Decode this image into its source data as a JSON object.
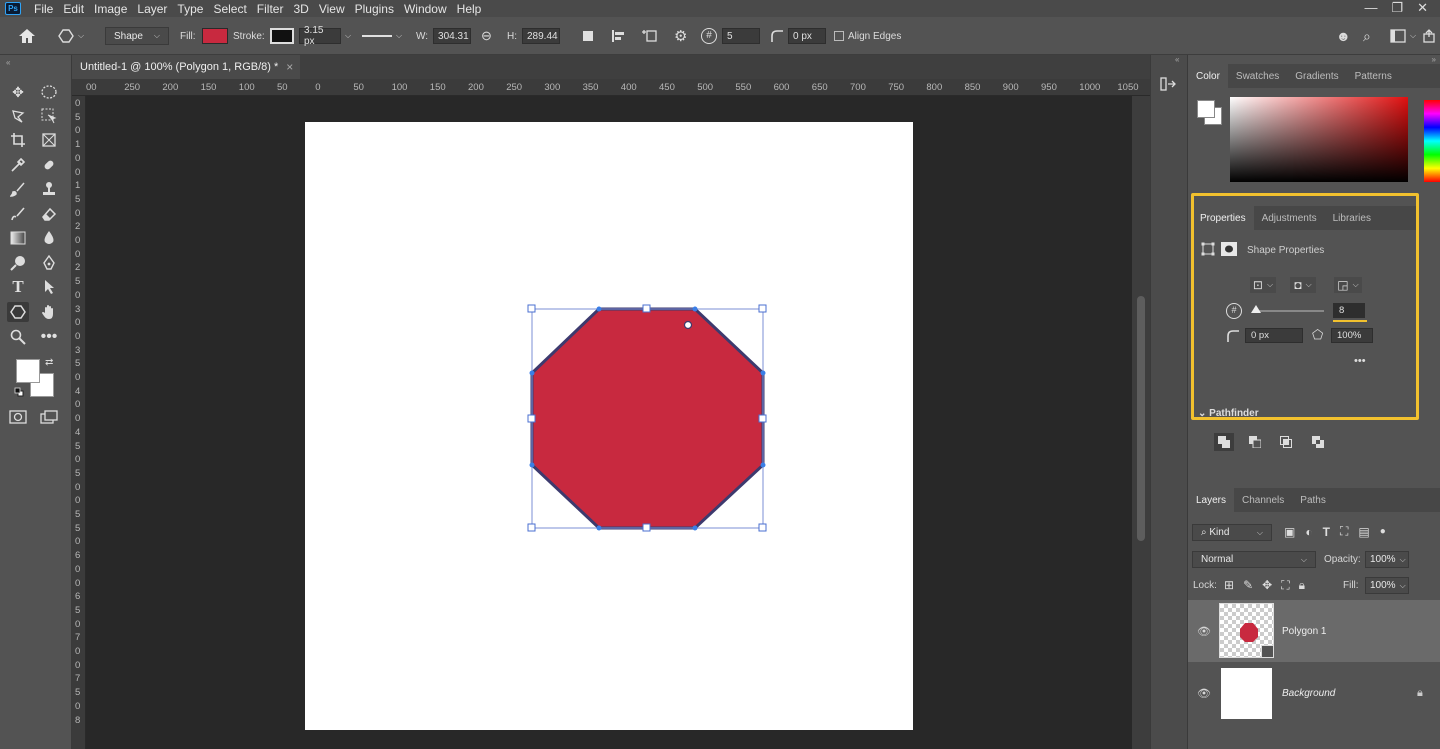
{
  "app": {
    "logo": "Ps"
  },
  "menu": [
    "File",
    "Edit",
    "Image",
    "Layer",
    "Type",
    "Select",
    "Filter",
    "3D",
    "View",
    "Plugins",
    "Window",
    "Help"
  ],
  "window_controls": {
    "minimize": "—",
    "restore": "❐",
    "close": "✕"
  },
  "options_bar": {
    "mode": "Shape",
    "fill_label": "Fill:",
    "fill_color": "#c8293f",
    "stroke_label": "Stroke:",
    "stroke_width": "3.15 px",
    "w_label": "W:",
    "w_value": "304.31",
    "h_label": "H:",
    "h_value": "289.44",
    "sides": "5",
    "corner_radius": "0 px",
    "align_edges": "Align Edges"
  },
  "document_tab": {
    "title": "Untitled-1 @ 100% (Polygon 1, RGB/8) *",
    "close": "×"
  },
  "rulers": {
    "horizontal": [
      "00",
      "250",
      "200",
      "150",
      "100",
      "50",
      "0",
      "50",
      "100",
      "150",
      "200",
      "250",
      "300",
      "350",
      "400",
      "450",
      "500",
      "550",
      "600",
      "650",
      "700",
      "750",
      "800",
      "850",
      "900",
      "950",
      "1000",
      "1050"
    ],
    "vertical": [
      "0",
      "5",
      "0",
      "1",
      "0",
      "0",
      "1",
      "5",
      "0",
      "2",
      "0",
      "0",
      "2",
      "5",
      "0",
      "3",
      "0",
      "0",
      "3",
      "5",
      "0",
      "4",
      "0",
      "0",
      "4",
      "5",
      "0",
      "5",
      "0",
      "0",
      "5",
      "5",
      "0",
      "6",
      "0",
      "0",
      "6",
      "5",
      "0",
      "7",
      "0",
      "0",
      "7",
      "5",
      "0",
      "8"
    ]
  },
  "canvas": {
    "shape_fill": "#c8293f",
    "shape_stroke": "#3d3a6e"
  },
  "color_panel": {
    "tabs": [
      "Color",
      "Swatches",
      "Gradients",
      "Patterns"
    ],
    "hue": "#e01010"
  },
  "properties_panel": {
    "tabs": [
      "Properties",
      "Adjustments",
      "Libraries"
    ],
    "section_title": "Shape Properties",
    "sides_value": "8",
    "corner_radius": "0 px",
    "star_ratio": "100%",
    "more": "•••",
    "pathfinder_label": "Pathfinder",
    "highlight_color": "#f2c12e"
  },
  "layers_panel": {
    "tabs": [
      "Layers",
      "Channels",
      "Paths"
    ],
    "filter_kind": "Kind",
    "blend_mode": "Normal",
    "opacity_label": "Opacity:",
    "opacity_value": "100%",
    "lock_label": "Lock:",
    "fill_label": "Fill:",
    "fill_value": "100%",
    "layers": [
      {
        "name": "Polygon 1"
      },
      {
        "name": "Background"
      }
    ]
  }
}
